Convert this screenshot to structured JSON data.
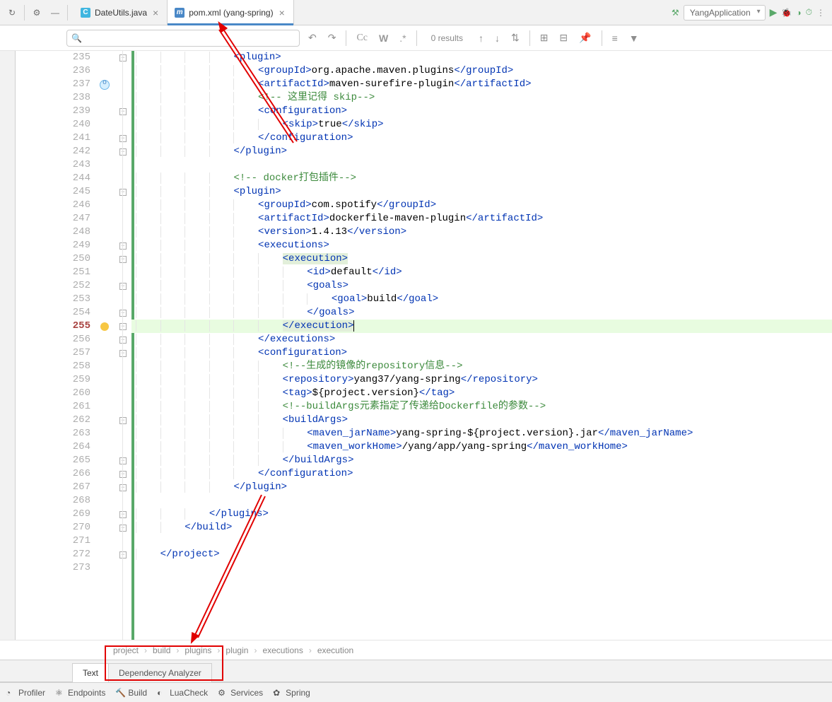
{
  "run_config": "YangApplication",
  "tabs": [
    {
      "label": "DateUtils.java",
      "icon": "C",
      "active": false
    },
    {
      "label": "pom.xml (yang-spring)",
      "icon": "m",
      "active": true
    }
  ],
  "search": {
    "placeholder": "",
    "results": "0 results"
  },
  "lines": {
    "start": 235,
    "end": 273,
    "current": 255,
    "icon237": true,
    "bulb255": true
  },
  "code": [
    {
      "n": 235,
      "indent": 4,
      "parts": [
        {
          "t": "tag",
          "v": "<plugin>"
        }
      ]
    },
    {
      "n": 236,
      "indent": 5,
      "parts": [
        {
          "t": "tag",
          "v": "<groupId>"
        },
        {
          "t": "txt",
          "v": "org.apache.maven.plugins"
        },
        {
          "t": "tag",
          "v": "</groupId>"
        }
      ]
    },
    {
      "n": 237,
      "indent": 5,
      "parts": [
        {
          "t": "tag",
          "v": "<artifactId>"
        },
        {
          "t": "txt",
          "v": "maven-surefire-plugin"
        },
        {
          "t": "tag",
          "v": "</artifactId>"
        }
      ]
    },
    {
      "n": 238,
      "indent": 5,
      "parts": [
        {
          "t": "comment-cn",
          "v": "<!-- 这里记得 skip-->"
        }
      ]
    },
    {
      "n": 239,
      "indent": 5,
      "parts": [
        {
          "t": "tag",
          "v": "<configuration>"
        }
      ]
    },
    {
      "n": 240,
      "indent": 6,
      "parts": [
        {
          "t": "tag",
          "v": "<skip>"
        },
        {
          "t": "txt",
          "v": "true"
        },
        {
          "t": "tag",
          "v": "</skip>"
        }
      ]
    },
    {
      "n": 241,
      "indent": 5,
      "parts": [
        {
          "t": "tag",
          "v": "</configuration>"
        }
      ]
    },
    {
      "n": 242,
      "indent": 4,
      "parts": [
        {
          "t": "tag",
          "v": "</plugin>"
        }
      ]
    },
    {
      "n": 243,
      "indent": 0,
      "parts": []
    },
    {
      "n": 244,
      "indent": 4,
      "parts": [
        {
          "t": "comment-cn",
          "v": "<!-- docker打包插件-->"
        }
      ]
    },
    {
      "n": 245,
      "indent": 4,
      "parts": [
        {
          "t": "tag",
          "v": "<plugin>"
        }
      ]
    },
    {
      "n": 246,
      "indent": 5,
      "parts": [
        {
          "t": "tag",
          "v": "<groupId>"
        },
        {
          "t": "txt",
          "v": "com.spotify"
        },
        {
          "t": "tag",
          "v": "</groupId>"
        }
      ]
    },
    {
      "n": 247,
      "indent": 5,
      "parts": [
        {
          "t": "tag",
          "v": "<artifactId>"
        },
        {
          "t": "txt",
          "v": "dockerfile-maven-plugin"
        },
        {
          "t": "tag",
          "v": "</artifactId>"
        }
      ]
    },
    {
      "n": 248,
      "indent": 5,
      "parts": [
        {
          "t": "tag",
          "v": "<version>"
        },
        {
          "t": "txt",
          "v": "1.4.13"
        },
        {
          "t": "tag",
          "v": "</version>"
        }
      ]
    },
    {
      "n": 249,
      "indent": 5,
      "parts": [
        {
          "t": "tag",
          "v": "<executions>"
        }
      ]
    },
    {
      "n": 250,
      "indent": 6,
      "parts": [
        {
          "t": "tag",
          "v": "<execution>",
          "hl": true
        }
      ]
    },
    {
      "n": 251,
      "indent": 7,
      "parts": [
        {
          "t": "tag",
          "v": "<id>"
        },
        {
          "t": "txt",
          "v": "default"
        },
        {
          "t": "tag",
          "v": "</id>"
        }
      ]
    },
    {
      "n": 252,
      "indent": 7,
      "parts": [
        {
          "t": "tag",
          "v": "<goals>"
        }
      ]
    },
    {
      "n": 253,
      "indent": 8,
      "parts": [
        {
          "t": "tag",
          "v": "<goal>"
        },
        {
          "t": "txt",
          "v": "build"
        },
        {
          "t": "tag",
          "v": "</goal>"
        }
      ]
    },
    {
      "n": 254,
      "indent": 7,
      "parts": [
        {
          "t": "tag",
          "v": "</goals>"
        }
      ]
    },
    {
      "n": 255,
      "indent": 6,
      "parts": [
        {
          "t": "tag",
          "v": "</execution>",
          "hl": true,
          "caret": true
        }
      ],
      "current": true
    },
    {
      "n": 256,
      "indent": 5,
      "parts": [
        {
          "t": "tag",
          "v": "</executions>"
        }
      ]
    },
    {
      "n": 257,
      "indent": 5,
      "parts": [
        {
          "t": "tag",
          "v": "<configuration>"
        }
      ]
    },
    {
      "n": 258,
      "indent": 6,
      "parts": [
        {
          "t": "comment-cn",
          "v": "<!--生成的镜像的repository信息-->"
        }
      ]
    },
    {
      "n": 259,
      "indent": 6,
      "parts": [
        {
          "t": "tag",
          "v": "<repository>"
        },
        {
          "t": "txt",
          "v": "yang37/yang-spring"
        },
        {
          "t": "tag",
          "v": "</repository>"
        }
      ]
    },
    {
      "n": 260,
      "indent": 6,
      "parts": [
        {
          "t": "tag",
          "v": "<tag>"
        },
        {
          "t": "txt",
          "v": "${project.version}"
        },
        {
          "t": "tag",
          "v": "</tag>"
        }
      ]
    },
    {
      "n": 261,
      "indent": 6,
      "parts": [
        {
          "t": "comment-cn",
          "v": "<!--buildArgs元素指定了传递给Dockerfile的参数-->"
        }
      ]
    },
    {
      "n": 262,
      "indent": 6,
      "parts": [
        {
          "t": "tag",
          "v": "<buildArgs>"
        }
      ]
    },
    {
      "n": 263,
      "indent": 7,
      "parts": [
        {
          "t": "tag",
          "v": "<maven_jarName>"
        },
        {
          "t": "txt",
          "v": "yang-spring-${project.version}.jar"
        },
        {
          "t": "tag",
          "v": "</maven_jarName>"
        }
      ]
    },
    {
      "n": 264,
      "indent": 7,
      "parts": [
        {
          "t": "tag",
          "v": "<maven_workHome>"
        },
        {
          "t": "txt",
          "v": "/yang/app/yang-spring"
        },
        {
          "t": "tag",
          "v": "</maven_workHome>"
        }
      ]
    },
    {
      "n": 265,
      "indent": 6,
      "parts": [
        {
          "t": "tag",
          "v": "</buildArgs>"
        }
      ]
    },
    {
      "n": 266,
      "indent": 5,
      "parts": [
        {
          "t": "tag",
          "v": "</configuration>"
        }
      ]
    },
    {
      "n": 267,
      "indent": 4,
      "parts": [
        {
          "t": "tag",
          "v": "</plugin>"
        }
      ]
    },
    {
      "n": 268,
      "indent": 0,
      "parts": []
    },
    {
      "n": 269,
      "indent": 3,
      "parts": [
        {
          "t": "tag",
          "v": "</plugins>"
        }
      ]
    },
    {
      "n": 270,
      "indent": 2,
      "parts": [
        {
          "t": "tag",
          "v": "</build>"
        }
      ]
    },
    {
      "n": 271,
      "indent": 0,
      "parts": []
    },
    {
      "n": 272,
      "indent": 1,
      "parts": [
        {
          "t": "tag",
          "v": "</project>"
        }
      ]
    },
    {
      "n": 273,
      "indent": 0,
      "parts": []
    }
  ],
  "fold_markers": {
    "235": "-",
    "239": "-",
    "241": "-",
    "242": "-",
    "245": "-",
    "249": "-",
    "250": "-",
    "252": "-",
    "254": "-",
    "255": "-",
    "256": "-",
    "257": "-",
    "262": "-",
    "265": "-",
    "266": "-",
    "267": "-",
    "269": "-",
    "270": "-",
    "272": "-"
  },
  "breadcrumb": [
    "project",
    "build",
    "plugins",
    "plugin",
    "executions",
    "execution"
  ],
  "view_tabs": [
    {
      "label": "Text",
      "active": true
    },
    {
      "label": "Dependency Analyzer",
      "active": false
    }
  ],
  "bottom_bar": [
    {
      "icon": "profiler",
      "label": "Profiler"
    },
    {
      "icon": "endpoints",
      "label": "Endpoints"
    },
    {
      "icon": "build",
      "label": "Build"
    },
    {
      "icon": "luacheck",
      "label": "LuaCheck"
    },
    {
      "icon": "services",
      "label": "Services"
    },
    {
      "icon": "spring",
      "label": "Spring"
    }
  ]
}
